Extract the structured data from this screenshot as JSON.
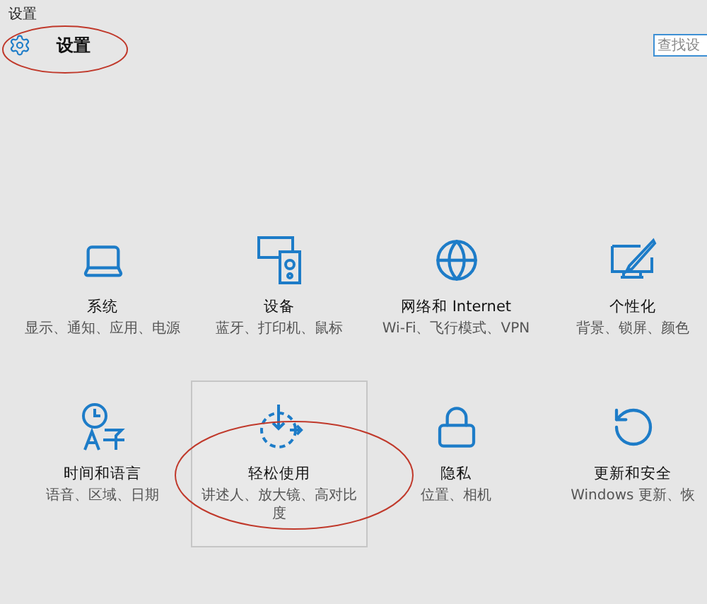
{
  "window": {
    "title": "设置"
  },
  "header": {
    "title": "设置"
  },
  "search": {
    "placeholder": "查找设"
  },
  "tiles": [
    {
      "title": "系统",
      "description": "显示、通知、应用、电源",
      "selected": false
    },
    {
      "title": "设备",
      "description": "蓝牙、打印机、鼠标",
      "selected": false
    },
    {
      "title": "网络和 Internet",
      "description": "Wi-Fi、飞行模式、VPN",
      "selected": false
    },
    {
      "title": "个性化",
      "description": "背景、锁屏、颜色",
      "selected": false
    },
    {
      "title": "时间和语言",
      "description": "语音、区域、日期",
      "selected": false
    },
    {
      "title": "轻松使用",
      "description": "讲述人、放大镜、高对比度",
      "selected": true
    },
    {
      "title": "隐私",
      "description": "位置、相机",
      "selected": false
    },
    {
      "title": "更新和安全",
      "description": "Windows 更新、恢",
      "selected": false
    }
  ]
}
